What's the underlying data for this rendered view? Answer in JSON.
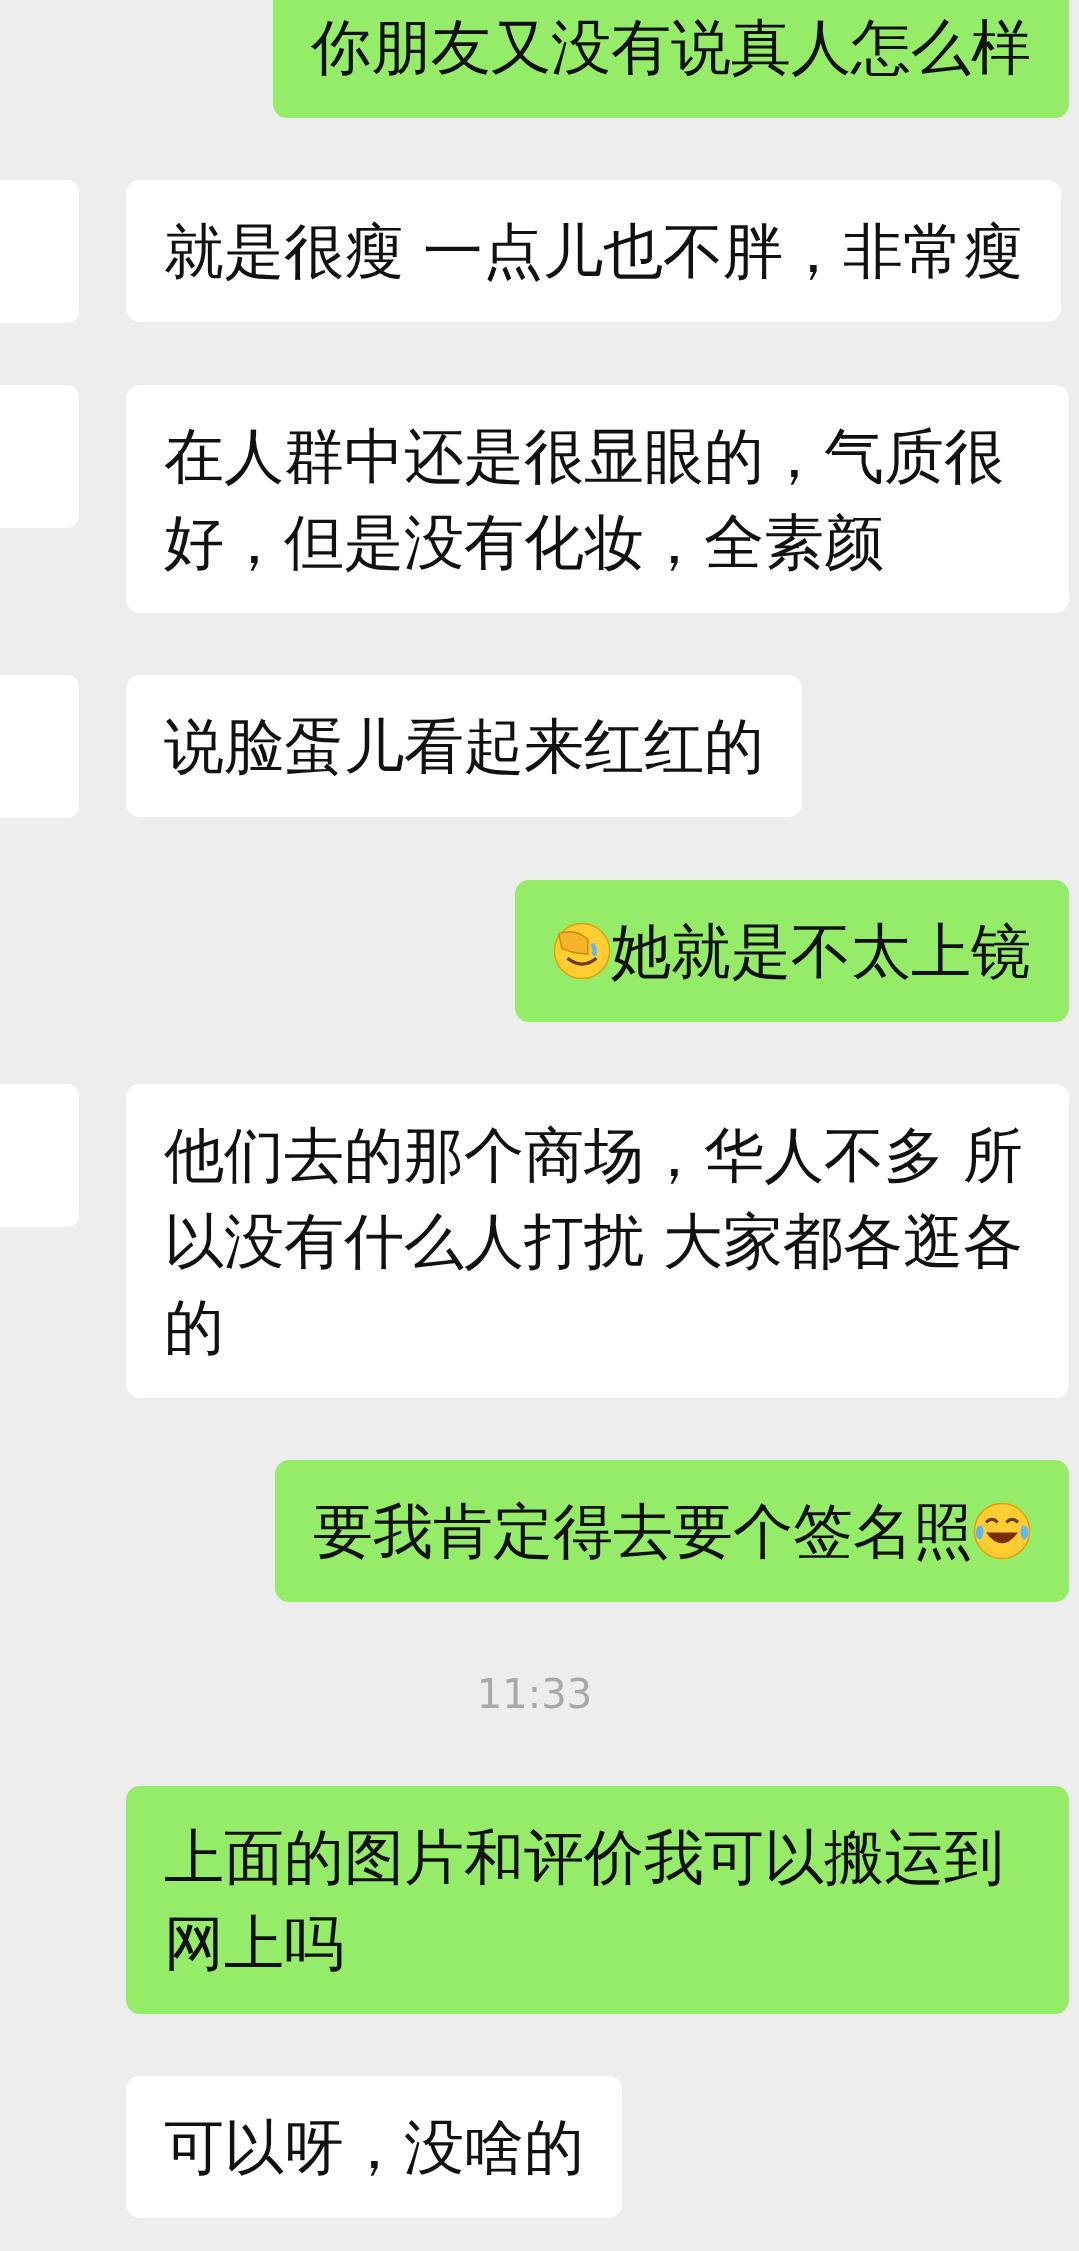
{
  "messages": [
    {
      "kind": "sent",
      "text": "你朋友又没有说真人怎么样",
      "leading_emoji": false,
      "trailing_emoji": false
    },
    {
      "kind": "received",
      "text": "就是很瘦 一点儿也不胖，非常瘦",
      "avatar": true
    },
    {
      "kind": "received",
      "text": "在人群中还是很显眼的，气质很好，但是没有化妆，全素颜",
      "avatar": true
    },
    {
      "kind": "received",
      "text": "说脸蛋儿看起来红红的",
      "avatar": true
    },
    {
      "kind": "sent",
      "text": "她就是不太上镜",
      "leading_emoji": true,
      "trailing_emoji": false
    },
    {
      "kind": "received",
      "text": "他们去的那个商场，华人不多 所以没有什么人打扰 大家都各逛各的",
      "avatar": true
    },
    {
      "kind": "sent",
      "text": "要我肯定得去要个签名照",
      "leading_emoji": false,
      "trailing_emoji": true
    },
    {
      "kind": "time",
      "text": "11:33"
    },
    {
      "kind": "sent",
      "text": "上面的图片和评价我可以搬运到网上吗",
      "leading_emoji": false,
      "trailing_emoji": false
    },
    {
      "kind": "received",
      "text": "可以呀，没啥的",
      "avatar": false
    }
  ]
}
